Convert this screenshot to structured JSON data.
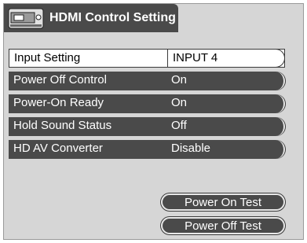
{
  "title": "HDMI Control Setting",
  "title_icon": "hdmi-device-icon",
  "rows": [
    {
      "label": "Input Setting",
      "value": "INPUT 4",
      "selected": true
    },
    {
      "label": "Power Off Control",
      "value": "On",
      "selected": false
    },
    {
      "label": "Power-On Ready",
      "value": "On",
      "selected": false
    },
    {
      "label": "Hold Sound Status",
      "value": "Off",
      "selected": false
    },
    {
      "label": "HD AV Converter",
      "value": "Disable",
      "selected": false
    }
  ],
  "buttons": {
    "power_on_test": "Power On Test",
    "power_off_test": "Power Off Test"
  },
  "colors": {
    "background": "#d6d6d6",
    "row_dark": "#4a4a4a",
    "highlight": "#ffffff"
  }
}
